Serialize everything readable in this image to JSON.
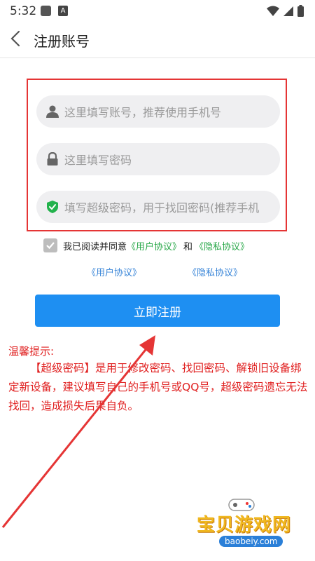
{
  "status_bar": {
    "time": "5:32",
    "notif_badge": "A"
  },
  "header": {
    "title": "注册账号"
  },
  "form": {
    "account_placeholder": "这里填写账号，推荐使用手机号",
    "password_placeholder": "这里填写密码",
    "super_password_placeholder": "填写超级密码，用于找回密码(推荐手机"
  },
  "agreement": {
    "prefix": "我已阅读并同意",
    "user_agreement": "《用户协议》",
    "and": "和",
    "privacy_policy": "《隐私协议》",
    "link_user_agreement": "《用户协议》",
    "link_privacy_policy": "《隐私协议》",
    "checked": true
  },
  "register_button": {
    "label": "立即注册"
  },
  "tip": {
    "title": "温馨提示:",
    "body": "【超级密码】是用于修改密码、找回密码、解锁旧设备绑定新设备，建议填写自己的手机号或QQ号，超级密码遗忘无法找回，造成损失后果自负。"
  },
  "watermark": {
    "brand": "宝贝游戏网",
    "domain": "baobeiy.com"
  },
  "colors": {
    "highlight_box": "#e53535",
    "button": "#1e8ff2",
    "link_green": "#2aa84a",
    "link_blue": "#3a86d8",
    "tip_red": "#e02020",
    "shield_green": "#22b24c"
  }
}
